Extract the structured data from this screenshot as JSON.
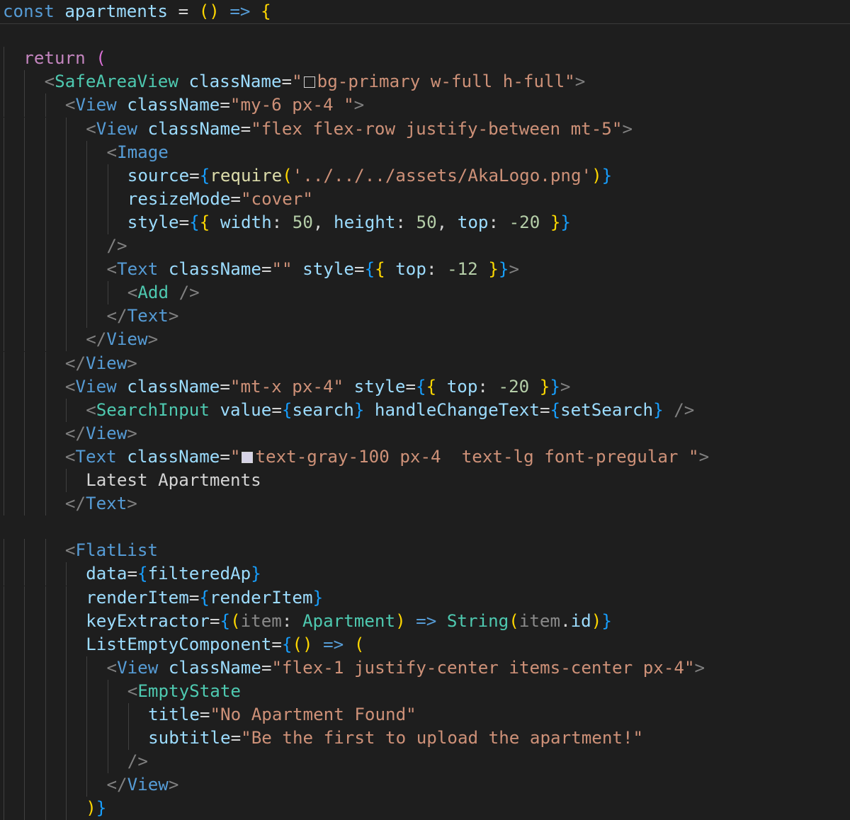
{
  "editor": {
    "colors": {
      "background": "#1e1e1e",
      "keyword": "#569cd6",
      "string": "#ce9178",
      "attribute": "#9cdcfe",
      "tag": "#569cd6",
      "tag_punct": "#808080",
      "number": "#b5cea8",
      "type": "#4ec9b0",
      "brace_gold": "#ffd700",
      "brace_violet": "#da70d6",
      "brace_blue": "#179fff"
    },
    "lines": [
      {
        "indent": 0,
        "tokens": [
          {
            "t": "const",
            "c": "keyword"
          },
          {
            "t": " apartments ",
            "c": "variable"
          },
          {
            "t": "= ",
            "c": "operator"
          },
          {
            "t": "()",
            "c": "brace1"
          },
          {
            "t": " => ",
            "c": "keyword"
          },
          {
            "t": "{",
            "c": "brace1"
          }
        ]
      },
      {
        "indent": 0,
        "tokens": []
      },
      {
        "indent": 1,
        "tokens": [
          {
            "t": "return",
            "c": "control"
          },
          {
            "t": " ",
            "c": "text"
          },
          {
            "t": "(",
            "c": "brace2"
          }
        ]
      },
      {
        "indent": 2,
        "tokens": [
          {
            "t": "<",
            "c": "tag-punct"
          },
          {
            "t": "SafeAreaView",
            "c": "component"
          },
          {
            "t": " className",
            "c": "attr"
          },
          {
            "t": "=",
            "c": "operator"
          },
          {
            "t": "\"",
            "c": "string"
          },
          {
            "swatch": "#1e1e1e"
          },
          {
            "t": "bg-primary w-full h-full\"",
            "c": "string"
          },
          {
            "t": ">",
            "c": "tag-punct"
          }
        ]
      },
      {
        "indent": 3,
        "tokens": [
          {
            "t": "<",
            "c": "tag-punct"
          },
          {
            "t": "View",
            "c": "tag"
          },
          {
            "t": " className",
            "c": "attr"
          },
          {
            "t": "=",
            "c": "operator"
          },
          {
            "t": "\"my-6 px-4 \"",
            "c": "string"
          },
          {
            "t": ">",
            "c": "tag-punct"
          }
        ]
      },
      {
        "indent": 4,
        "tokens": [
          {
            "t": "<",
            "c": "tag-punct"
          },
          {
            "t": "View",
            "c": "tag"
          },
          {
            "t": " className",
            "c": "attr"
          },
          {
            "t": "=",
            "c": "operator"
          },
          {
            "t": "\"flex flex-row justify-between mt-5\"",
            "c": "string"
          },
          {
            "t": ">",
            "c": "tag-punct"
          }
        ]
      },
      {
        "indent": 5,
        "tokens": [
          {
            "t": "<",
            "c": "tag-punct"
          },
          {
            "t": "Image",
            "c": "tag"
          }
        ]
      },
      {
        "indent": 6,
        "tokens": [
          {
            "t": "source",
            "c": "attr"
          },
          {
            "t": "=",
            "c": "operator"
          },
          {
            "t": "{",
            "c": "brace3"
          },
          {
            "t": "require",
            "c": "function"
          },
          {
            "t": "(",
            "c": "brace1"
          },
          {
            "t": "'../../../assets/AkaLogo.png'",
            "c": "string"
          },
          {
            "t": ")",
            "c": "brace1"
          },
          {
            "t": "}",
            "c": "brace3"
          }
        ]
      },
      {
        "indent": 6,
        "tokens": [
          {
            "t": "resizeMode",
            "c": "attr"
          },
          {
            "t": "=",
            "c": "operator"
          },
          {
            "t": "\"cover\"",
            "c": "string"
          }
        ]
      },
      {
        "indent": 6,
        "tokens": [
          {
            "t": "style",
            "c": "attr"
          },
          {
            "t": "=",
            "c": "operator"
          },
          {
            "t": "{",
            "c": "brace3"
          },
          {
            "t": "{",
            "c": "brace1"
          },
          {
            "t": " width",
            "c": "attr"
          },
          {
            "t": ": ",
            "c": "operator"
          },
          {
            "t": "50",
            "c": "number"
          },
          {
            "t": ", ",
            "c": "operator"
          },
          {
            "t": "height",
            "c": "attr"
          },
          {
            "t": ": ",
            "c": "operator"
          },
          {
            "t": "50",
            "c": "number"
          },
          {
            "t": ", ",
            "c": "operator"
          },
          {
            "t": "top",
            "c": "attr"
          },
          {
            "t": ": ",
            "c": "operator"
          },
          {
            "t": "-20",
            "c": "number"
          },
          {
            "t": " ",
            "c": "text"
          },
          {
            "t": "}",
            "c": "brace1"
          },
          {
            "t": "}",
            "c": "brace3"
          }
        ]
      },
      {
        "indent": 5,
        "tokens": [
          {
            "t": "/>",
            "c": "tag-punct"
          }
        ]
      },
      {
        "indent": 5,
        "tokens": [
          {
            "t": "<",
            "c": "tag-punct"
          },
          {
            "t": "Text",
            "c": "tag"
          },
          {
            "t": " className",
            "c": "attr"
          },
          {
            "t": "=",
            "c": "operator"
          },
          {
            "t": "\"\"",
            "c": "string"
          },
          {
            "t": " style",
            "c": "attr"
          },
          {
            "t": "=",
            "c": "operator"
          },
          {
            "t": "{",
            "c": "brace3"
          },
          {
            "t": "{",
            "c": "brace1"
          },
          {
            "t": " top",
            "c": "attr"
          },
          {
            "t": ": ",
            "c": "operator"
          },
          {
            "t": "-12",
            "c": "number"
          },
          {
            "t": " ",
            "c": "text"
          },
          {
            "t": "}",
            "c": "brace1"
          },
          {
            "t": "}",
            "c": "brace3"
          },
          {
            "t": ">",
            "c": "tag-punct"
          }
        ]
      },
      {
        "indent": 6,
        "tokens": [
          {
            "t": "<",
            "c": "tag-punct"
          },
          {
            "t": "Add",
            "c": "component"
          },
          {
            "t": " />",
            "c": "tag-punct"
          }
        ]
      },
      {
        "indent": 5,
        "tokens": [
          {
            "t": "</",
            "c": "tag-punct"
          },
          {
            "t": "Text",
            "c": "tag"
          },
          {
            "t": ">",
            "c": "tag-punct"
          }
        ]
      },
      {
        "indent": 4,
        "tokens": [
          {
            "t": "</",
            "c": "tag-punct"
          },
          {
            "t": "View",
            "c": "tag"
          },
          {
            "t": ">",
            "c": "tag-punct"
          }
        ]
      },
      {
        "indent": 3,
        "tokens": [
          {
            "t": "</",
            "c": "tag-punct"
          },
          {
            "t": "View",
            "c": "tag"
          },
          {
            "t": ">",
            "c": "tag-punct"
          }
        ]
      },
      {
        "indent": 3,
        "tokens": [
          {
            "t": "<",
            "c": "tag-punct"
          },
          {
            "t": "View",
            "c": "tag"
          },
          {
            "t": " className",
            "c": "attr"
          },
          {
            "t": "=",
            "c": "operator"
          },
          {
            "t": "\"mt-x px-4\"",
            "c": "string"
          },
          {
            "t": " style",
            "c": "attr"
          },
          {
            "t": "=",
            "c": "operator"
          },
          {
            "t": "{",
            "c": "brace3"
          },
          {
            "t": "{",
            "c": "brace1"
          },
          {
            "t": " top",
            "c": "attr"
          },
          {
            "t": ": ",
            "c": "operator"
          },
          {
            "t": "-20",
            "c": "number"
          },
          {
            "t": " ",
            "c": "text"
          },
          {
            "t": "}",
            "c": "brace1"
          },
          {
            "t": "}",
            "c": "brace3"
          },
          {
            "t": ">",
            "c": "tag-punct"
          }
        ]
      },
      {
        "indent": 4,
        "tokens": [
          {
            "t": "<",
            "c": "tag-punct"
          },
          {
            "t": "SearchInput",
            "c": "component"
          },
          {
            "t": " value",
            "c": "attr"
          },
          {
            "t": "=",
            "c": "operator"
          },
          {
            "t": "{",
            "c": "brace3"
          },
          {
            "t": "search",
            "c": "variable"
          },
          {
            "t": "}",
            "c": "brace3"
          },
          {
            "t": " handleChangeText",
            "c": "attr"
          },
          {
            "t": "=",
            "c": "operator"
          },
          {
            "t": "{",
            "c": "brace3"
          },
          {
            "t": "setSearch",
            "c": "variable"
          },
          {
            "t": "}",
            "c": "brace3"
          },
          {
            "t": " />",
            "c": "tag-punct"
          }
        ]
      },
      {
        "indent": 3,
        "tokens": [
          {
            "t": "</",
            "c": "tag-punct"
          },
          {
            "t": "View",
            "c": "tag"
          },
          {
            "t": ">",
            "c": "tag-punct"
          }
        ]
      },
      {
        "indent": 3,
        "tokens": [
          {
            "t": "<",
            "c": "tag-punct"
          },
          {
            "t": "Text",
            "c": "tag"
          },
          {
            "t": " className",
            "c": "attr"
          },
          {
            "t": "=",
            "c": "operator"
          },
          {
            "t": "\"",
            "c": "string"
          },
          {
            "swatch": "#d6d3e6"
          },
          {
            "t": "text-gray-100 px-4  text-lg font-pregular \"",
            "c": "string"
          },
          {
            "t": ">",
            "c": "tag-punct"
          }
        ]
      },
      {
        "indent": 4,
        "tokens": [
          {
            "t": "Latest Apartments",
            "c": "text"
          }
        ]
      },
      {
        "indent": 3,
        "tokens": [
          {
            "t": "</",
            "c": "tag-punct"
          },
          {
            "t": "Text",
            "c": "tag"
          },
          {
            "t": ">",
            "c": "tag-punct"
          }
        ]
      },
      {
        "indent": 0,
        "tokens": []
      },
      {
        "indent": 3,
        "tokens": [
          {
            "t": "<",
            "c": "tag-punct"
          },
          {
            "t": "FlatList",
            "c": "tag"
          }
        ]
      },
      {
        "indent": 4,
        "tokens": [
          {
            "t": "data",
            "c": "attr"
          },
          {
            "t": "=",
            "c": "operator"
          },
          {
            "t": "{",
            "c": "brace3"
          },
          {
            "t": "filteredAp",
            "c": "variable"
          },
          {
            "t": "}",
            "c": "brace3"
          }
        ]
      },
      {
        "indent": 4,
        "tokens": [
          {
            "t": "renderItem",
            "c": "attr"
          },
          {
            "t": "=",
            "c": "operator"
          },
          {
            "t": "{",
            "c": "brace3"
          },
          {
            "t": "renderItem",
            "c": "variable"
          },
          {
            "t": "}",
            "c": "brace3"
          }
        ]
      },
      {
        "indent": 4,
        "tokens": [
          {
            "t": "keyExtractor",
            "c": "attr"
          },
          {
            "t": "=",
            "c": "operator"
          },
          {
            "t": "{",
            "c": "brace3"
          },
          {
            "t": "(",
            "c": "brace1"
          },
          {
            "t": "item",
            "c": "muted"
          },
          {
            "t": ": ",
            "c": "operator"
          },
          {
            "t": "Apartment",
            "c": "type"
          },
          {
            "t": ")",
            "c": "brace1"
          },
          {
            "t": " => ",
            "c": "keyword"
          },
          {
            "t": "String",
            "c": "type"
          },
          {
            "t": "(",
            "c": "brace1"
          },
          {
            "t": "item",
            "c": "muted"
          },
          {
            "t": ".",
            "c": "operator"
          },
          {
            "t": "id",
            "c": "variable"
          },
          {
            "t": ")",
            "c": "brace1"
          },
          {
            "t": "}",
            "c": "brace3"
          }
        ]
      },
      {
        "indent": 4,
        "tokens": [
          {
            "t": "ListEmptyComponent",
            "c": "attr"
          },
          {
            "t": "=",
            "c": "operator"
          },
          {
            "t": "{",
            "c": "brace3"
          },
          {
            "t": "()",
            "c": "brace1"
          },
          {
            "t": " => ",
            "c": "keyword"
          },
          {
            "t": "(",
            "c": "brace1"
          }
        ]
      },
      {
        "indent": 5,
        "tokens": [
          {
            "t": "<",
            "c": "tag-punct"
          },
          {
            "t": "View",
            "c": "tag"
          },
          {
            "t": " className",
            "c": "attr"
          },
          {
            "t": "=",
            "c": "operator"
          },
          {
            "t": "\"flex-1 justify-center items-center px-4\"",
            "c": "string"
          },
          {
            "t": ">",
            "c": "tag-punct"
          }
        ]
      },
      {
        "indent": 6,
        "tokens": [
          {
            "t": "<",
            "c": "tag-punct"
          },
          {
            "t": "EmptyState",
            "c": "component"
          }
        ]
      },
      {
        "indent": 7,
        "tokens": [
          {
            "t": "title",
            "c": "attr"
          },
          {
            "t": "=",
            "c": "operator"
          },
          {
            "t": "\"No Apartment Found\"",
            "c": "string"
          }
        ]
      },
      {
        "indent": 7,
        "tokens": [
          {
            "t": "subtitle",
            "c": "attr"
          },
          {
            "t": "=",
            "c": "operator"
          },
          {
            "t": "\"Be the first to upload the apartment!\"",
            "c": "string"
          }
        ]
      },
      {
        "indent": 6,
        "tokens": [
          {
            "t": "/>",
            "c": "tag-punct"
          }
        ]
      },
      {
        "indent": 5,
        "tokens": [
          {
            "t": "</",
            "c": "tag-punct"
          },
          {
            "t": "View",
            "c": "tag"
          },
          {
            "t": ">",
            "c": "tag-punct"
          }
        ]
      },
      {
        "indent": 4,
        "tokens": [
          {
            "t": ")",
            "c": "brace1"
          },
          {
            "t": "}",
            "c": "brace3"
          }
        ]
      }
    ]
  }
}
